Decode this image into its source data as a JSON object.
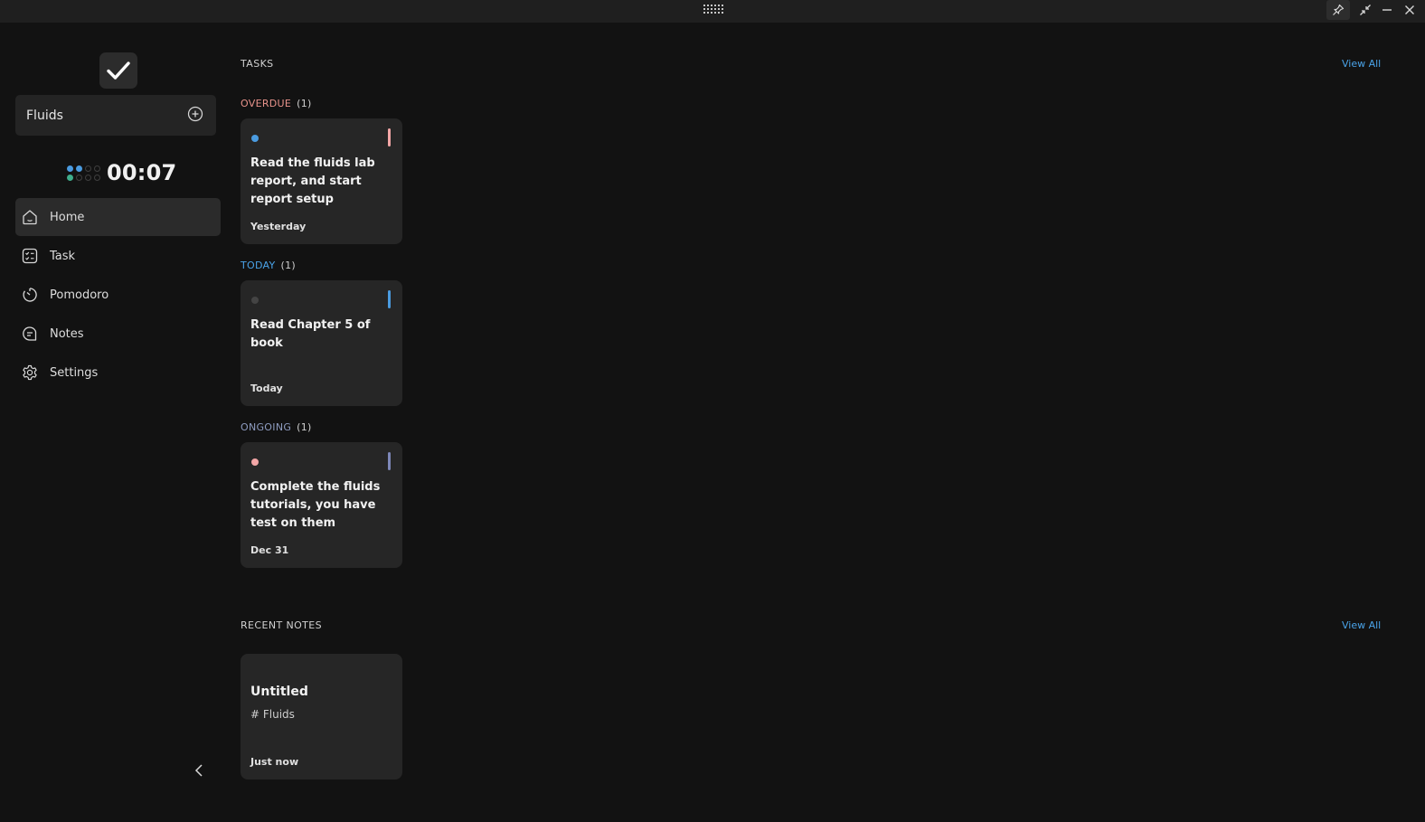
{
  "window": {
    "icons": [
      "drag-grip-icon",
      "pin-icon",
      "shrink-icon",
      "minimize-icon",
      "close-icon"
    ]
  },
  "sidebar": {
    "project": {
      "name": "Fluids",
      "add_icon": "plus-circle-icon"
    },
    "timer": {
      "value": "00:07"
    },
    "nav": [
      {
        "label": "Home",
        "icon": "home-icon",
        "active": true
      },
      {
        "label": "Task",
        "icon": "checklist-icon",
        "active": false
      },
      {
        "label": "Pomodoro",
        "icon": "timer-icon",
        "active": false
      },
      {
        "label": "Notes",
        "icon": "notes-icon",
        "active": false
      },
      {
        "label": "Settings",
        "icon": "gear-icon",
        "active": false
      }
    ]
  },
  "tasks": {
    "title": "TASKS",
    "view_all": "View All",
    "groups": [
      {
        "label": "OVERDUE",
        "count": "(1)",
        "color": "#e8938b",
        "cards": [
          {
            "title": "Read the fluids lab report, and start report setup",
            "date": "Yesterday",
            "dot_color": "#4a9be0",
            "bar_color": "#f2a6a6"
          }
        ]
      },
      {
        "label": "TODAY",
        "count": "(1)",
        "color": "#4aa3e8",
        "cards": [
          {
            "title": "Read Chapter 5 of book",
            "date": "Today",
            "dot_color": "#444444",
            "bar_color": "#4a9be0"
          }
        ]
      },
      {
        "label": "ONGOING",
        "count": "(1)",
        "color": "#8e9cc0",
        "cards": [
          {
            "title": "Complete the fluids tutorials, you have test on them",
            "date": "Dec 31",
            "dot_color": "#f2a6a6",
            "bar_color": "#7d87b8"
          }
        ]
      }
    ]
  },
  "notes": {
    "title": "RECENT NOTES",
    "view_all": "View All",
    "cards": [
      {
        "title": "Untitled",
        "tag": "# Fluids",
        "date": "Just now"
      }
    ]
  }
}
